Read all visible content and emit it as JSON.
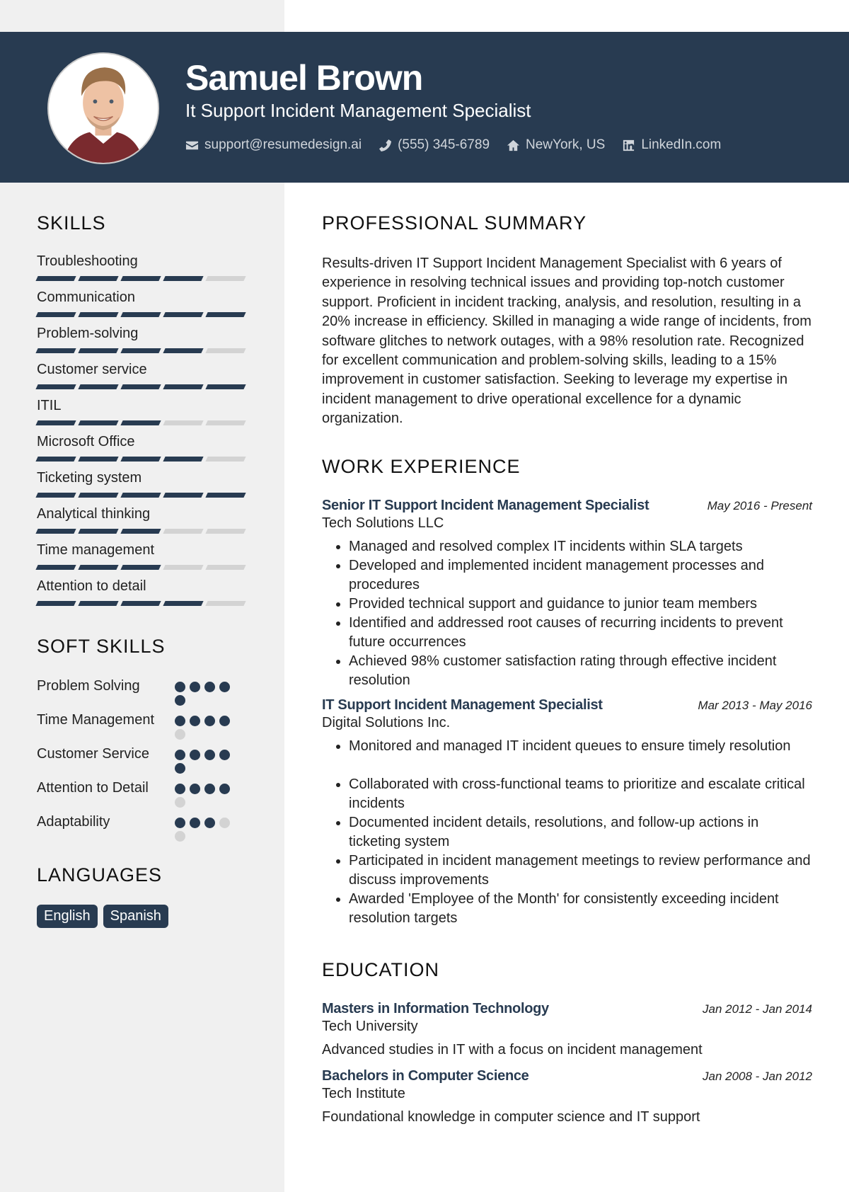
{
  "header": {
    "name": "Samuel Brown",
    "title": "It Support Incident Management Specialist",
    "contacts": [
      {
        "icon": "envelope-icon",
        "text": "support@resumedesign.ai"
      },
      {
        "icon": "phone-icon",
        "text": "(555) 345-6789"
      },
      {
        "icon": "home-icon",
        "text": "NewYork, US"
      },
      {
        "icon": "linkedin-icon",
        "text": "LinkedIn.com"
      }
    ]
  },
  "sidebar": {
    "skills_title": "SKILLS",
    "skills": [
      {
        "name": "Troubleshooting",
        "level": 4,
        "max": 5
      },
      {
        "name": "Communication",
        "level": 5,
        "max": 5
      },
      {
        "name": "Problem-solving",
        "level": 4,
        "max": 5
      },
      {
        "name": "Customer service",
        "level": 5,
        "max": 5
      },
      {
        "name": "ITIL",
        "level": 3,
        "max": 5
      },
      {
        "name": "Microsoft Office",
        "level": 4,
        "max": 5
      },
      {
        "name": "Ticketing system",
        "level": 5,
        "max": 5
      },
      {
        "name": "Analytical thinking",
        "level": 3,
        "max": 5
      },
      {
        "name": "Time management",
        "level": 3,
        "max": 5
      },
      {
        "name": "Attention to detail",
        "level": 4,
        "max": 5
      }
    ],
    "soft_title": "SOFT SKILLS",
    "soft_skills": [
      {
        "name": "Problem Solving",
        "level": 5,
        "max": 5
      },
      {
        "name": "Time Management",
        "level": 4,
        "max": 5
      },
      {
        "name": "Customer Service",
        "level": 5,
        "max": 5
      },
      {
        "name": "Attention to Detail",
        "level": 4,
        "max": 5
      },
      {
        "name": "Adaptability",
        "level": 3,
        "max": 5
      }
    ],
    "languages_title": "LANGUAGES",
    "languages": [
      "English",
      "Spanish"
    ]
  },
  "main": {
    "summary_title": "PROFESSIONAL SUMMARY",
    "summary": "Results-driven IT Support Incident Management Specialist with 6 years of experience in resolving technical issues and providing top-notch customer support. Proficient in incident tracking, analysis, and resolution, resulting in a 20% increase in efficiency. Skilled in managing a wide range of incidents, from software glitches to network outages, with a 98% resolution rate. Recognized for excellent communication and problem-solving skills, leading to a 15% improvement in customer satisfaction. Seeking to leverage my expertise in incident management to drive operational excellence for a dynamic organization.",
    "work_title": "WORK EXPERIENCE",
    "jobs": [
      {
        "title": "Senior IT Support Incident Management Specialist",
        "dates": "May 2016 - Present",
        "company": "Tech Solutions LLC",
        "bullets": [
          "Managed and resolved complex IT incidents within SLA targets",
          "Developed and implemented incident management processes and procedures",
          "Provided technical support and guidance to junior team members",
          "Identified and addressed root causes of recurring incidents to prevent future occurrences",
          "Achieved 98% customer satisfaction rating through effective incident resolution"
        ]
      },
      {
        "title": "IT Support Incident Management Specialist",
        "dates": "Mar 2013 - May 2016",
        "company": "Digital Solutions Inc.",
        "bullets": [
          "Monitored and managed IT incident queues to ensure timely resolution",
          "Collaborated with cross-functional teams to prioritize and escalate critical incidents",
          "Documented incident details, resolutions, and follow-up actions in ticketing system",
          "Participated in incident management meetings to review performance and discuss improvements",
          "Awarded 'Employee of the Month' for consistently exceeding incident resolution targets"
        ]
      }
    ],
    "education_title": "EDUCATION",
    "education": [
      {
        "degree": "Masters in Information Technology",
        "dates": "Jan 2012 - Jan 2014",
        "school": "Tech University",
        "description": "Advanced studies in IT with a focus on incident management"
      },
      {
        "degree": "Bachelors in Computer Science",
        "dates": "Jan 2008 - Jan 2012",
        "school": "Tech Institute",
        "description": "Foundational knowledge in computer science and IT support"
      }
    ]
  }
}
